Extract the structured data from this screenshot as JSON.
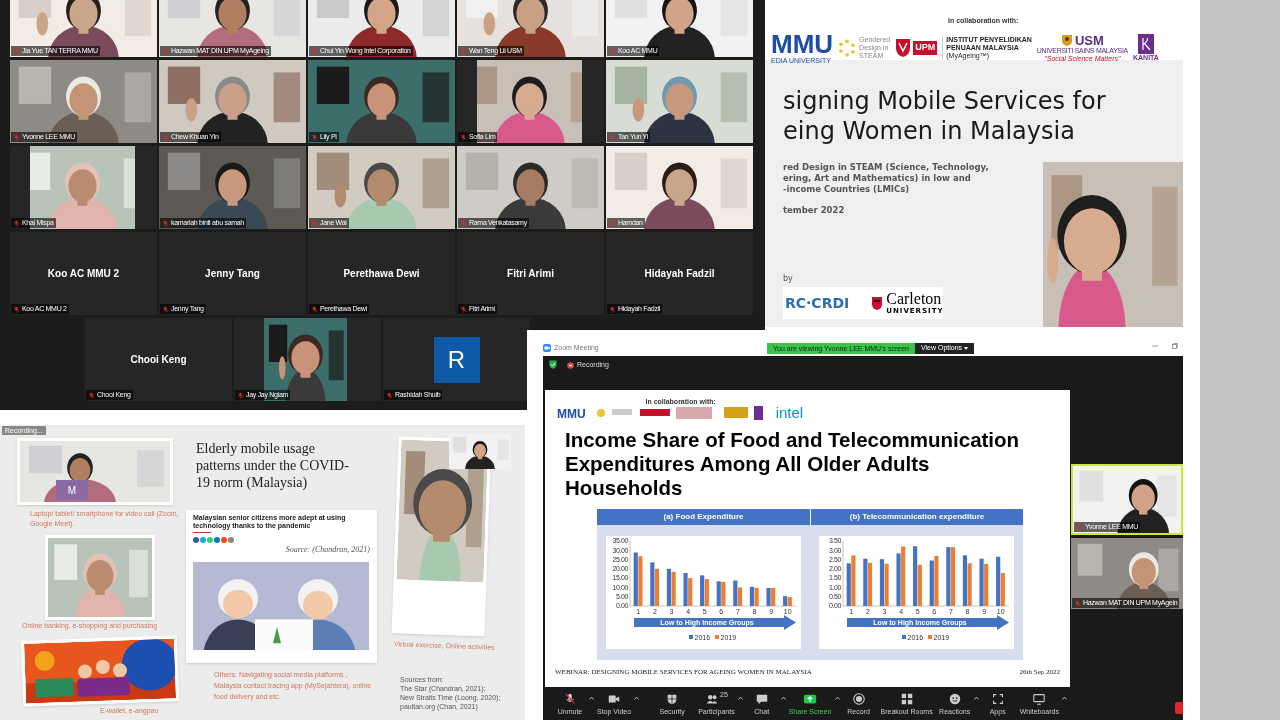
{
  "gallery": {
    "tiles": [
      {
        "name": "Jia Yue TAN TERRA MMU",
        "kind": "video",
        "muted": true
      },
      {
        "name": "Hazwan MAT DIN UPM MyAgeing",
        "kind": "video",
        "muted": true
      },
      {
        "name": "Chui Yin Wong Intel Corporation",
        "kind": "video",
        "muted": true
      },
      {
        "name": "Wan Teng Lii USM",
        "kind": "video",
        "muted": true
      },
      {
        "name": "Koo AC MMU",
        "kind": "video",
        "muted": true
      },
      {
        "name": "Yvonne LEE MMU",
        "kind": "video",
        "muted": true
      },
      {
        "name": "Chew Khuan Yin",
        "kind": "video",
        "muted": true
      },
      {
        "name": "Lily Pi",
        "kind": "video",
        "muted": true
      },
      {
        "name": "Sofia Lim",
        "kind": "video",
        "muted": true
      },
      {
        "name": "Tan Yun Yi",
        "kind": "video",
        "muted": true
      },
      {
        "name": "Khai Mispa",
        "kind": "video",
        "muted": true
      },
      {
        "name": "kamariah binti abu samah",
        "kind": "video",
        "muted": true
      },
      {
        "name": "Jane Wai",
        "kind": "video",
        "muted": true
      },
      {
        "name": "Rama Venkatasamy",
        "kind": "video",
        "muted": true
      },
      {
        "name": "Hamdan",
        "kind": "video",
        "muted": true
      },
      {
        "name": "Koo AC MMU 2",
        "kind": "name",
        "display_name": "Koo AC MMU 2",
        "muted": true
      },
      {
        "name": "Jenny Tang",
        "kind": "name",
        "display_name": "Jenny Tang",
        "muted": true
      },
      {
        "name": "Perethawa Dewi",
        "kind": "name",
        "display_name": "Perethawa Dewi",
        "muted": true
      },
      {
        "name": "Fitri Arimi",
        "kind": "name",
        "display_name": "Fitri Arimi",
        "muted": true
      },
      {
        "name": "Hidayah Fadzil",
        "kind": "name",
        "display_name": "Hidayah Fadzil",
        "muted": true
      },
      {
        "name": "Chooi Keng",
        "kind": "name",
        "display_name": "Chooi Keng",
        "muted": true
      },
      {
        "name": "Jay Jay Ngiam",
        "kind": "video",
        "muted": true
      },
      {
        "name": "Rashidah Shuib",
        "kind": "avatar",
        "initial": "R",
        "muted": true
      }
    ]
  },
  "title_slide": {
    "collab_label": "In collaboration with:",
    "logos": [
      {
        "kind": "mmu",
        "lines": [
          "MMU",
          "EDIA UNIVERSITY"
        ]
      },
      {
        "kind": "gendered",
        "lines": [
          "Gendered",
          "Design in",
          "STEAM"
        ]
      },
      {
        "kind": "upm",
        "lines": [
          "UPM"
        ]
      },
      {
        "kind": "ippm",
        "lines": [
          "INSTITUT PENYELIDIKAN",
          "PENUAAN MALAYSIA",
          "(MyAgeing™)"
        ]
      },
      {
        "kind": "usm",
        "lines": [
          "USM",
          "UNIVERSITI SAINS MALAYSIA",
          "\"Social Science Matters\""
        ]
      },
      {
        "kind": "kanita",
        "lines": [
          "KANITA"
        ]
      }
    ],
    "title_lines": [
      "signing Mobile Services for",
      "eing Women in Malaysia"
    ],
    "subtitle_lines": [
      "red Design in STEAM (Science, Technology,",
      "ering, Art and Mathematics) in low and",
      "-income Countries (LMICs)"
    ],
    "date": "tember 2022",
    "by_label": "by",
    "sponsors": [
      {
        "kind": "idrc",
        "lines": [
          "RC·CRDI"
        ]
      },
      {
        "kind": "carleton",
        "lines": [
          "Carleton",
          "UNIVERSITY"
        ]
      }
    ]
  },
  "usage_slide": {
    "recording": "Recording...",
    "title": "Elderly mobile usage patterns under the COVID-19 norm (Malaysia)",
    "video_call_avatar": "M",
    "video_call_caption": "Laptop/ tablet/ smartphone for video call (Zoom, Google Meet).",
    "banking_caption": "Online banking, e-shopping and purchasing",
    "ewallet_caption": "E-wallet, e-angpau",
    "article": {
      "headline": "Malaysian senior citizens more adept at using technology thanks to the pandemic",
      "source": "Source: (Chandran, 2021)"
    },
    "others_caption": "Others: Navigating social media platforms , Malaysia contact tracing app (MySejahtera), online food delivery and etc.",
    "virtual_caption": "Virtual exercise, Online activities",
    "sources": [
      "Sources from:",
      "The Star (Chandran, 2021);",
      "New Straits Time (Loong, 2020);",
      "paultan.org (Chan, 2021)"
    ]
  },
  "zoom_window": {
    "title": "Zoom Meeting",
    "banner": "You are viewing Yvonne LEE MMU's screen",
    "view_options": "View Options",
    "recording": "Recording",
    "slide": {
      "collab_label": "In collaboration with:",
      "logos": [
        "MMU",
        "intel"
      ],
      "title": "Income Share of Food and Telecommunication Expenditures Among All Older Adults Households",
      "panels": [
        {
          "header": "(a) Food Expenditure",
          "chart_data": {
            "type": "bar",
            "legend": "bottom",
            "xlabel": "Low to High Income Groups",
            "categories": [
              "1",
              "2",
              "3",
              "4",
              "5",
              "6",
              "7",
              "8",
              "9",
              "10"
            ],
            "ylim": [
              0,
              35
            ],
            "yticks": [
              {
                "value": 0,
                "label": "0.00"
              },
              {
                "value": 5,
                "label": "5.00"
              },
              {
                "value": 10,
                "label": "10.00"
              },
              {
                "value": 15,
                "label": "15.00"
              },
              {
                "value": 20,
                "label": "20.00"
              },
              {
                "value": 25,
                "label": "25.00"
              },
              {
                "value": 30,
                "label": "30.00"
              },
              {
                "value": 35,
                "label": "35.00"
              }
            ],
            "series": [
              {
                "name": "2016",
                "color": "#4472c4",
                "values": [
                  28.8,
                  23.5,
                  20.0,
                  17.8,
                  16.5,
                  13.3,
                  13.7,
                  10.3,
                  9.7,
                  5.3
                ]
              },
              {
                "name": "2019",
                "color": "#ed7d31",
                "values": [
                  26.8,
                  20.0,
                  18.4,
                  15.0,
                  14.5,
                  13.0,
                  10.0,
                  9.8,
                  9.7,
                  4.8
                ]
              }
            ]
          }
        },
        {
          "header": "(b) Telecommunication expenditure",
          "chart_data": {
            "type": "bar",
            "legend": "bottom",
            "xlabel": "Low to High Income Groups",
            "categories": [
              "1",
              "2",
              "3",
              "4",
              "5",
              "6",
              "7",
              "8",
              "9",
              "10"
            ],
            "ylim": [
              0,
              3.5
            ],
            "yticks": [
              {
                "value": 0,
                "label": "0.00"
              },
              {
                "value": 0.5,
                "label": "0.50"
              },
              {
                "value": 1,
                "label": "1.00"
              },
              {
                "value": 1.5,
                "label": "1.50"
              },
              {
                "value": 2,
                "label": "2.00"
              },
              {
                "value": 2.5,
                "label": "2.50"
              },
              {
                "value": 3,
                "label": "3.00"
              },
              {
                "value": 3.5,
                "label": "3.50"
              }
            ],
            "series": [
              {
                "name": "2016",
                "color": "#4472c4",
                "values": [
                  2.3,
                  2.55,
                  2.52,
                  2.83,
                  3.22,
                  2.45,
                  3.17,
                  2.73,
                  2.55,
                  2.65
                ]
              },
              {
                "name": "2019",
                "color": "#ed7d31",
                "values": [
                  2.72,
                  2.32,
                  2.28,
                  3.2,
                  2.22,
                  2.7,
                  3.17,
                  2.3,
                  2.27,
                  1.78
                ]
              }
            ]
          }
        }
      ],
      "footer": "WEBINAR: DESIGNING MOBILE SERVICES FOR AGEING WOMEN IN MALAYSIA",
      "date": "26th Sep 2022"
    },
    "videos": [
      {
        "name": "Yvonne LEE MMU",
        "speaking": true,
        "muted": true
      },
      {
        "name": "Hazwan MAT DIN UPM MyAgein",
        "speaking": false,
        "muted": true
      }
    ],
    "toolbar": [
      {
        "label": "Unmute",
        "kind": "mic-off",
        "has_menu": true
      },
      {
        "label": "Stop Video",
        "kind": "video",
        "has_menu": true
      },
      {
        "label": "Security",
        "kind": "security",
        "has_menu": false
      },
      {
        "label": "Participants",
        "kind": "participants",
        "count": "25",
        "has_menu": true
      },
      {
        "label": "Chat",
        "kind": "chat",
        "has_menu": true
      },
      {
        "label": "Share Screen",
        "kind": "share",
        "has_menu": true
      },
      {
        "label": "Record",
        "kind": "record",
        "has_menu": false
      },
      {
        "label": "Breakout Rooms",
        "kind": "breakout",
        "has_menu": false
      },
      {
        "label": "Reactions",
        "kind": "reactions",
        "has_menu": true
      },
      {
        "label": "Apps",
        "kind": "apps",
        "has_menu": false
      },
      {
        "label": "Whiteboards",
        "kind": "whiteboard",
        "has_menu": true
      }
    ]
  }
}
